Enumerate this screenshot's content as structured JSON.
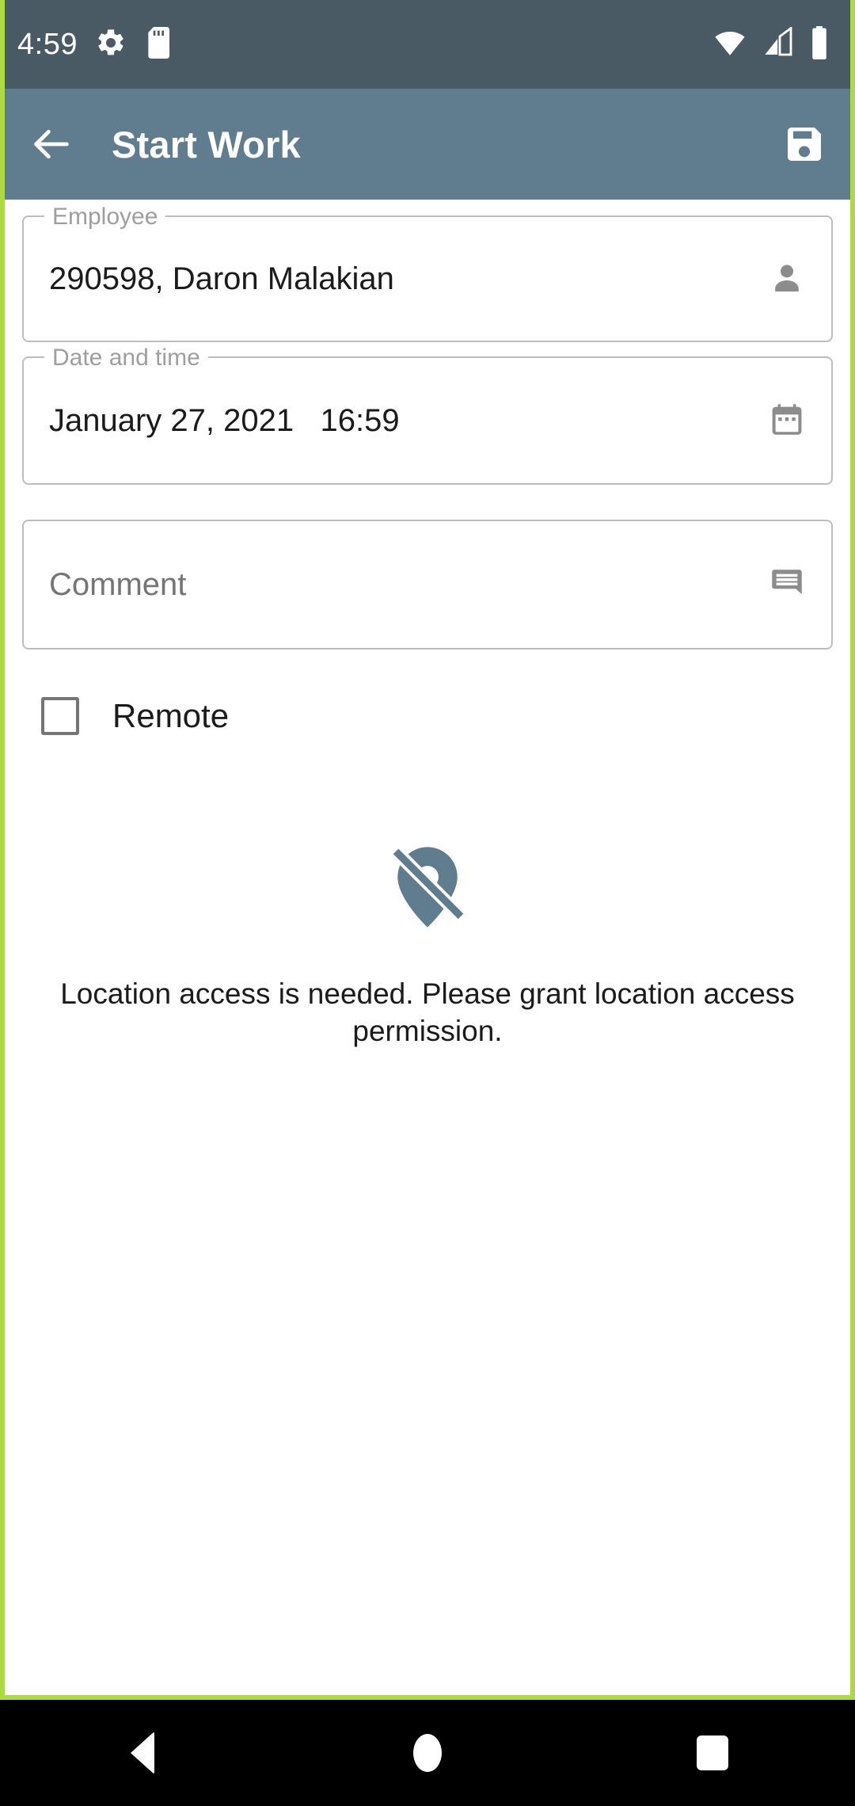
{
  "status_bar": {
    "time": "4:59",
    "left_icons": [
      "gear-icon",
      "sd-card-icon"
    ],
    "right_icons": [
      "wifi-icon",
      "cellular-signal-icon",
      "battery-icon"
    ],
    "background_color": "#4A5A64"
  },
  "app_bar": {
    "back_icon": "back-arrow-icon",
    "title": "Start Work",
    "save_icon": "save-floppy-icon",
    "background_color": "#5F7D8F"
  },
  "theme": {
    "accent_border_color": "#AEDB3C",
    "icon_gray": "#8C8C8C",
    "primary_blue_gray": "#5F7D8F"
  },
  "form": {
    "employee": {
      "label": "Employee",
      "value": "290598, Daron Malakian",
      "icon": "person-icon"
    },
    "datetime": {
      "label": "Date and time",
      "value": "January 27, 2021   16:59",
      "icon": "calendar-icon"
    },
    "comment": {
      "label": "Comment",
      "placeholder": "Comment",
      "value": "",
      "icon": "comment-bubble-icon"
    },
    "remote": {
      "label": "Remote",
      "checked": false
    }
  },
  "permission_state": {
    "icon": "location-off-icon",
    "message": "Location access is needed. Please grant location access permission."
  },
  "nav_bar": {
    "back_label": "Back",
    "home_label": "Home",
    "recents_label": "Recents"
  }
}
